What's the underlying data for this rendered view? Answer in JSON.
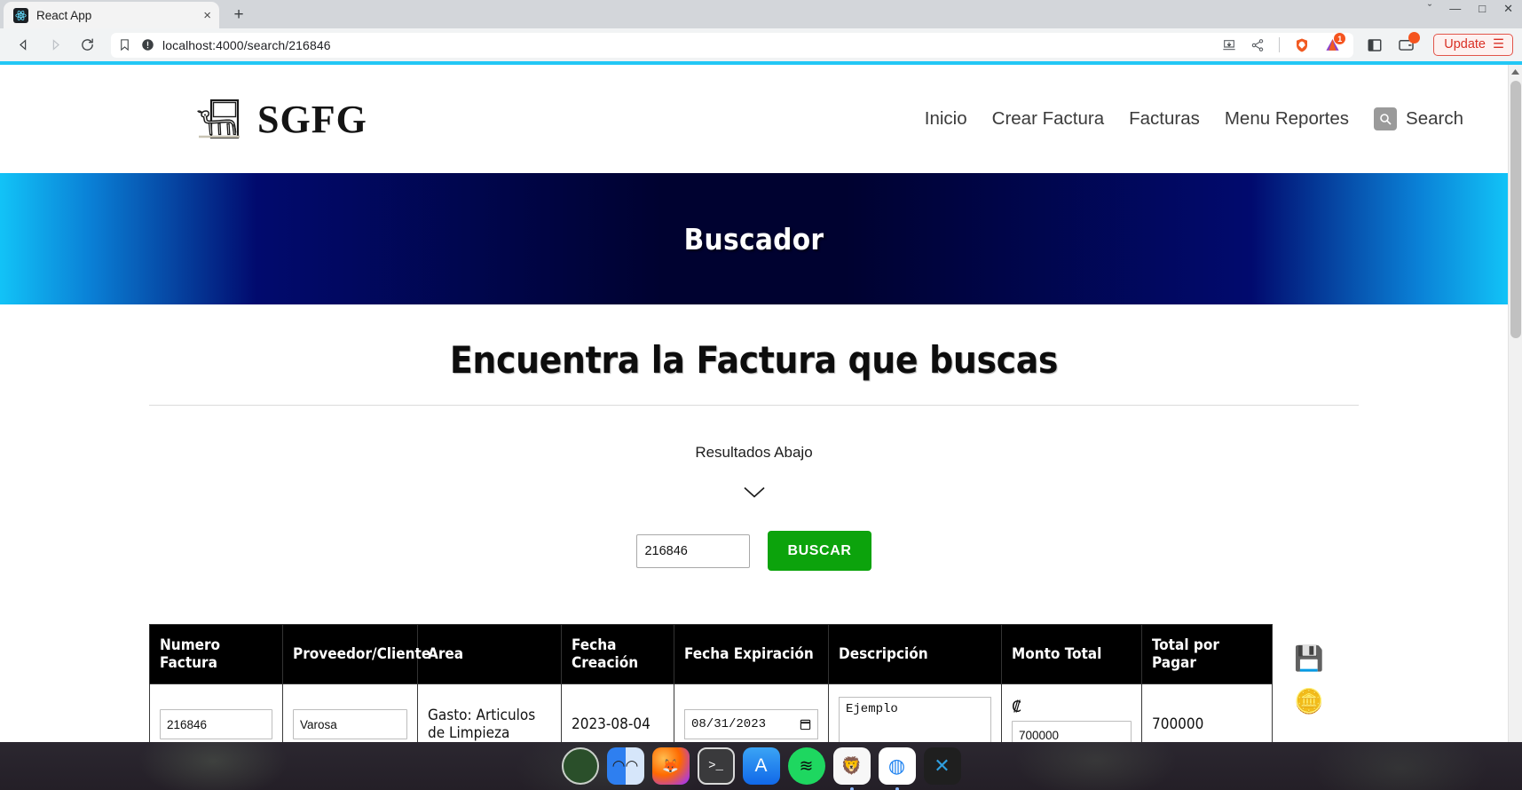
{
  "browser": {
    "tab": {
      "title": "React App",
      "favicon": "react-icon",
      "close_label": "×"
    },
    "newtab_label": "+",
    "window_controls": {
      "minimize": "—",
      "maximize": "□",
      "close": "✕",
      "chevron": "ˇ"
    },
    "url": "localhost:4000/search/216846",
    "url_security_icon": "not-secure-icon",
    "bookmark_icon": "bookmark-icon",
    "toolbar_icons": [
      "install-icon",
      "share-icon",
      "brave-shields-icon",
      "brave-rewards-icon",
      "sidebar-icon",
      "wallet-icon"
    ],
    "rewards_badge": "1",
    "update_button": {
      "label": "Update",
      "menu_glyph": "☰"
    }
  },
  "site_header": {
    "logo_text": "SGFG",
    "logo_icon": "cow-logo-icon",
    "nav": [
      {
        "label": "Inicio",
        "name": "nav-inicio"
      },
      {
        "label": "Crear Factura",
        "name": "nav-crear-factura"
      },
      {
        "label": "Facturas",
        "name": "nav-facturas"
      },
      {
        "label": "Menu Reportes",
        "name": "nav-menu-reportes"
      }
    ],
    "search": {
      "label": "Search",
      "icon": "search-icon"
    }
  },
  "banner": {
    "title": "Buscador"
  },
  "main": {
    "heading": "Encuentra la Factura que buscas",
    "results_note": "Resultados Abajo",
    "chevron_icon": "chevron-down-icon",
    "search": {
      "value": "216846",
      "placeholder": "",
      "button_label": "BUSCAR",
      "button_color": "#0ca30c"
    }
  },
  "table": {
    "columns": [
      "Numero Factura",
      "Proveedor/Cliente",
      "Area",
      "Fecha Creación",
      "Fecha Expiración",
      "Descripción",
      "Monto Total",
      "Total por Pagar"
    ],
    "rows": [
      {
        "numero_factura": "216846",
        "proveedor_cliente": "Varosa",
        "area": "Gasto: Articulos de Limpieza",
        "fecha_creacion": "2023-08-04",
        "fecha_expiracion": "08/31/2023",
        "descripcion": "Ejemplo",
        "currency_symbol": "₡",
        "monto_total": "700000",
        "total_por_pagar": "700000"
      }
    ],
    "actions": [
      {
        "icon": "save-floppy-icon",
        "glyph": "💾"
      },
      {
        "icon": "coin-money-icon",
        "glyph": "🪙"
      }
    ]
  },
  "dock": {
    "items": [
      {
        "name": "dock-item-launcher",
        "glyph": "●",
        "bg": "#2e5a2e",
        "color": "#2f7a35"
      },
      {
        "name": "dock-item-finder",
        "glyph": "☺",
        "bg": "#3b8ff5",
        "color": "#ffffff"
      },
      {
        "name": "dock-item-firefox",
        "glyph": "🦊",
        "bg": "#ff7139",
        "color": "#ffffff"
      },
      {
        "name": "dock-item-terminal",
        "glyph": ">_",
        "bg": "#3a3a3c",
        "color": "#ffffff"
      },
      {
        "name": "dock-item-app-store",
        "glyph": "A",
        "bg": "#1e82f0",
        "color": "#ffffff"
      },
      {
        "name": "dock-item-spotify",
        "glyph": "♫",
        "bg": "#1ed760",
        "color": "#0b0b0b"
      },
      {
        "name": "dock-item-brave",
        "glyph": "🦁",
        "bg": "#f7f7f7",
        "color": "#eb4a25"
      },
      {
        "name": "dock-item-chrome",
        "glyph": "◎",
        "bg": "#ffffff",
        "color": "#1e82f0"
      },
      {
        "name": "dock-item-vscode",
        "glyph": "✕",
        "bg": "#1f1f1f",
        "color": "#2f9fe0"
      }
    ]
  }
}
